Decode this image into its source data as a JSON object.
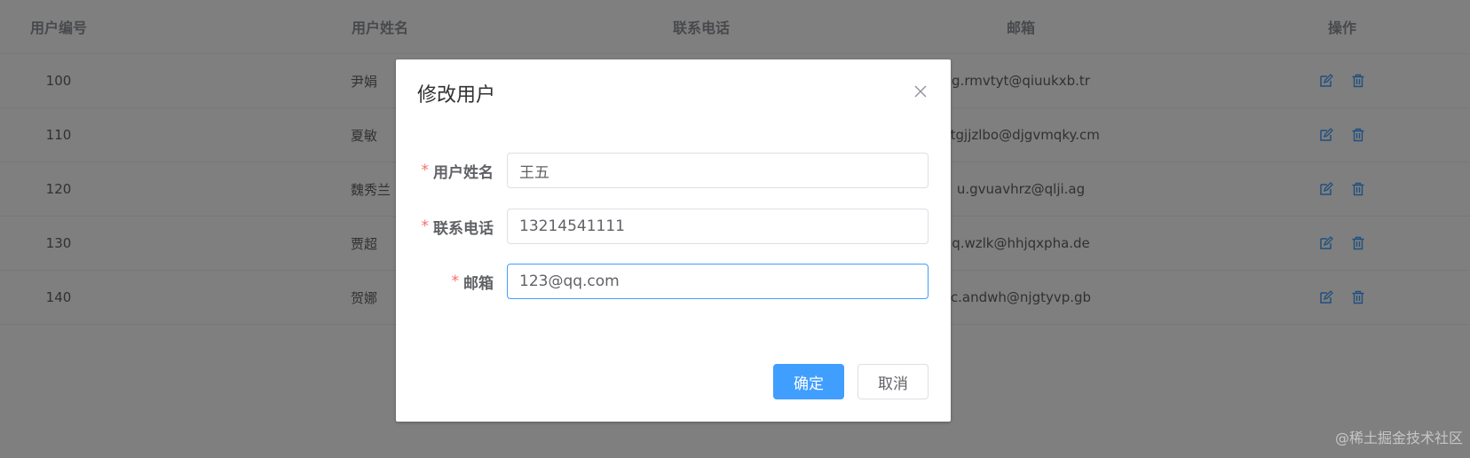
{
  "table": {
    "headers": {
      "id": "用户编号",
      "name": "用户姓名",
      "tel": "联系电话",
      "mail": "邮箱",
      "ops": "操作"
    },
    "rows": [
      {
        "id": "100",
        "name": "尹娟",
        "mail": "g.rmvtyt@qiuukxb.tr"
      },
      {
        "id": "110",
        "name": "夏敏",
        "mail": "ntgjjzlbo@djgvmqky.cm"
      },
      {
        "id": "120",
        "name": "魏秀兰",
        "mail": "u.gvuavhrz@qlji.ag"
      },
      {
        "id": "130",
        "name": "贾超",
        "mail": "q.wzlk@hhjqxpha.de"
      },
      {
        "id": "140",
        "name": "贺娜",
        "mail": "c.andwh@njgtyvp.gb"
      }
    ],
    "op_icons": [
      "edit-icon",
      "delete-icon"
    ],
    "icon_color": "#409eff"
  },
  "dialog": {
    "title": "修改用户",
    "close_icon": "close-icon",
    "fields": {
      "name": {
        "label": "用户姓名",
        "value": "王五"
      },
      "tel": {
        "label": "联系电话",
        "value": "13214541111"
      },
      "mail": {
        "label": "邮箱",
        "value": "123@qq.com"
      }
    },
    "required_mark": "*",
    "confirm_label": "确定",
    "cancel_label": "取消"
  },
  "watermark": "@稀土掘金技术社区",
  "colors": {
    "primary": "#409eff",
    "required": "#f56c6c",
    "overlay": "rgba(0,0,0,0.5)"
  }
}
